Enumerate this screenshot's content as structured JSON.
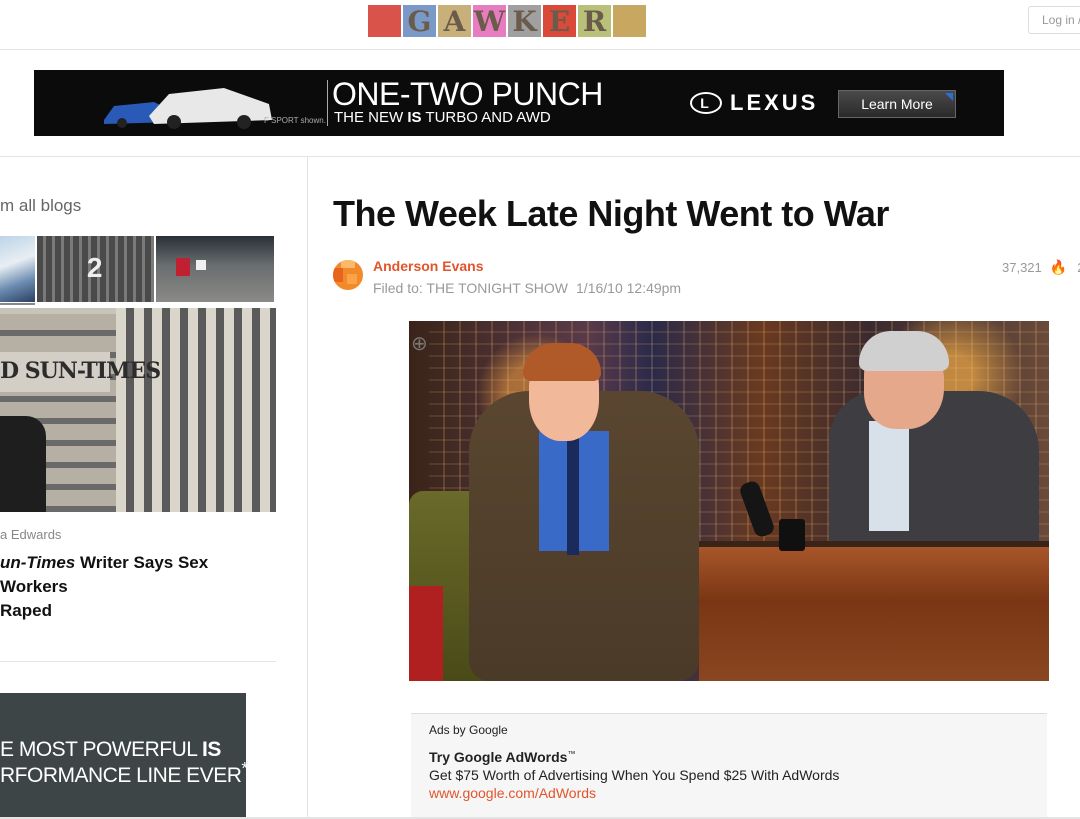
{
  "header": {
    "logo_letters": [
      "",
      "G",
      "A",
      "W",
      "K",
      "E",
      "R",
      ""
    ],
    "logo_colors": [
      "#d9534a",
      "#7b99c8",
      "#c7b07a",
      "#e87cc0",
      "#a0a0a0",
      "#d94a3a",
      "#b8c07a",
      "#c8a860"
    ],
    "login_label": "Log in /"
  },
  "banner_ad": {
    "headline": "ONE-TWO PUNCH",
    "subline_pre": "THE NEW ",
    "subline_bold": "IS",
    "subline_post": " TURBO AND AWD",
    "fine_print": "F SPORT shown.",
    "brand": "LEXUS",
    "brand_mark": "L",
    "cta_label": "Learn More"
  },
  "sidebar": {
    "from_blogs_label": "m all blogs",
    "thumbnail_count": "2",
    "feature_sign": "D SUN-TIMES",
    "byline": "a Edwards",
    "story_title_italic": "un-Times",
    "story_title_rest": " Writer Says Sex Workers",
    "story_title_line2": "Raped",
    "ad_line1_pre": "E MOST POWERFUL ",
    "ad_line1_bold": "IS",
    "ad_line2": "RFORMANCE LINE EVER",
    "ad_line2_mark": "*"
  },
  "article": {
    "title": "The Week Late Night Went to War",
    "author": "Anderson Evans",
    "filed_to": "Filed to: THE TONIGHT SHOW",
    "timestamp": "1/16/10 12:49pm",
    "view_count": "37,321",
    "extra_count": "2",
    "flame_icon": "🔥",
    "zoom_icon": "⊕"
  },
  "google_ads": {
    "label": "Ads by Google",
    "ad_title": "Try Google AdWords",
    "ad_title_mark": "™",
    "ad_text": "Get $75 Worth of Advertising When You Spend $25 With AdWords",
    "ad_url": "www.google.com/AdWords"
  }
}
